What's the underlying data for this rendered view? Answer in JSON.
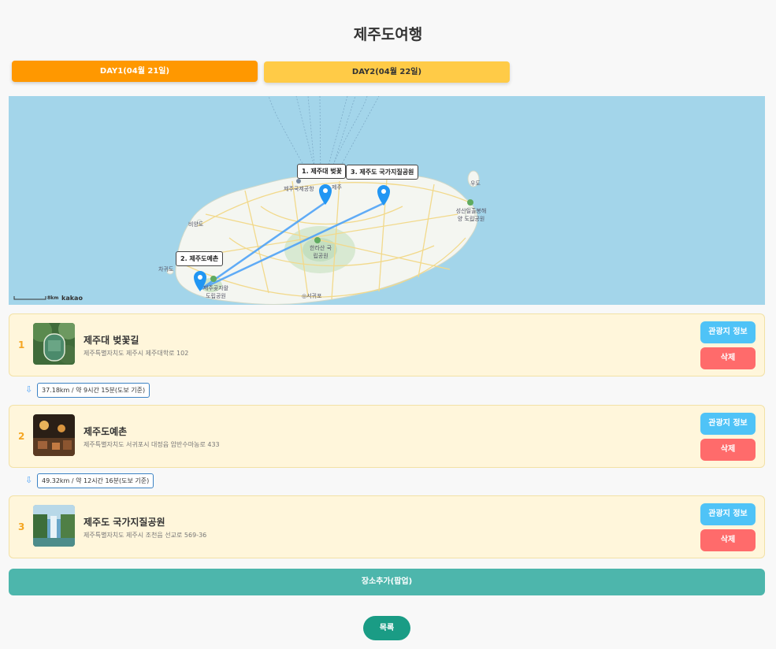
{
  "page": {
    "title": "제주도여행"
  },
  "tabs": [
    {
      "label": "DAY1(04월 21일)",
      "active": true
    },
    {
      "label": "DAY2(04월 22일)",
      "active": false
    }
  ],
  "map": {
    "labels": {
      "m1": "1. 제주대 벚꽃",
      "m2": "2. 제주도예촌",
      "m3": "3. 제주도 국가지질공원"
    },
    "places": {
      "airport": "제주국제공항",
      "jeju": "제주",
      "biyangdo": "비양도",
      "udo": "우도",
      "hallasan": "한라산 국립공원",
      "seongsan": "성산일출봉해양 도립공원",
      "seogwipo": "◎서귀포",
      "jeju_gf": "제주곶자왈 도립공원",
      "jagwido": "차귀도"
    },
    "scale": "8km",
    "provider": "kakao"
  },
  "places": [
    {
      "index": "1",
      "name": "제주대 벚꽃길",
      "address": "제주특별자치도 제주시 제주대학로 102",
      "info_label": "관광지 정보",
      "delete_label": "삭제"
    },
    {
      "index": "2",
      "name": "제주도예촌",
      "address": "제주특별자치도 서귀포시 대정읍 암반수마농로 433",
      "info_label": "관광지 정보",
      "delete_label": "삭제"
    },
    {
      "index": "3",
      "name": "제주도 국가지질공원",
      "address": "제주특별자치도 제주시 조천읍 선교로 569-36",
      "info_label": "관광지 정보",
      "delete_label": "삭제"
    }
  ],
  "distances": [
    {
      "arrow": "⇩",
      "text": "37.18km / 약 9시간 15분(도보 기준)"
    },
    {
      "arrow": "⇩",
      "text": "49.32km / 약 12시간 16분(도보 기준)"
    }
  ],
  "actions": {
    "add_label": "장소추가(팝업)",
    "list_label": "목록"
  },
  "colors": {
    "tab_active": "#ff9800",
    "tab_inactive": "#ffcb47",
    "info_button": "#4fc3f7",
    "delete_button": "#ff6b6b",
    "add_button": "#4db6ac",
    "list_button": "#1a9c85",
    "route_line": "#4fa3f7",
    "marker": "#2196f3"
  }
}
